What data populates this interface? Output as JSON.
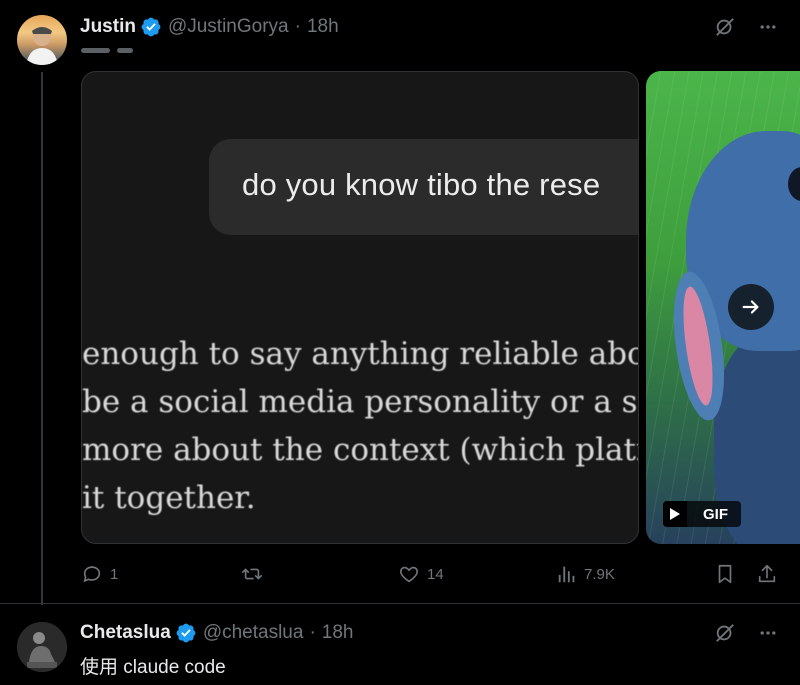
{
  "tweet1": {
    "author_name": "Justin",
    "handle": "@JustinGorya",
    "separator": "·",
    "time": "18h",
    "media": {
      "bubble_text": "do you know tibo the rese",
      "body_lines": [
        "enough to say anything reliable abou",
        " be a social media personality or a sp",
        " more about the context (which platf",
        " it together."
      ],
      "gif_label": "GIF"
    },
    "actions": {
      "replies": "1",
      "likes": "14",
      "views": "7.9K"
    }
  },
  "tweet2": {
    "author_name": "Chetaslua",
    "handle": "@chetaslua",
    "separator": "·",
    "time": "18h",
    "text": "使用 claude code"
  },
  "colors": {
    "background": "#000000",
    "text_primary": "#e7e9ea",
    "text_secondary": "#71767b",
    "verified_blue": "#1d9bf0",
    "divider": "#2f3336"
  }
}
